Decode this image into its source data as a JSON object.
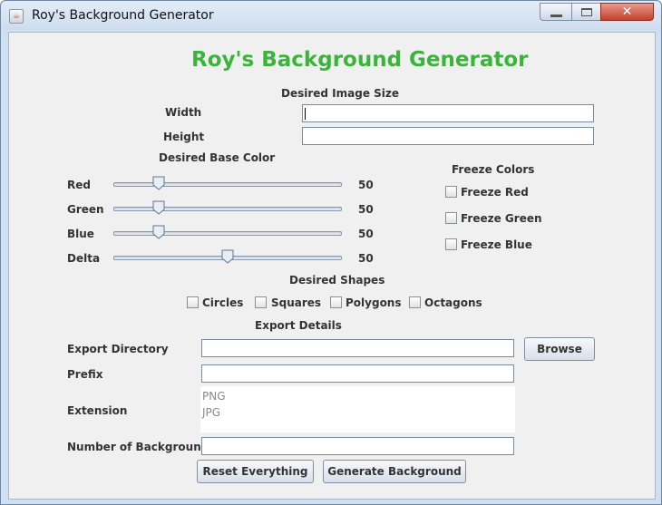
{
  "window": {
    "title": "Roy's Background Generator",
    "icon": "java-app-icon",
    "controls": {
      "minimize": "minimize-icon",
      "maximize": "maximize-icon",
      "close": "✕"
    }
  },
  "heading": "Roy's Background Generator",
  "image_size": {
    "section_label": "Desired Image Size",
    "width_label": "Width",
    "width_value": "",
    "height_label": "Height",
    "height_value": ""
  },
  "base_color": {
    "section_label": "Desired Base Color",
    "sliders": [
      {
        "label": "Red",
        "value": "50",
        "fraction": 0.198
      },
      {
        "label": "Green",
        "value": "50",
        "fraction": 0.198
      },
      {
        "label": "Blue",
        "value": "50",
        "fraction": 0.198
      },
      {
        "label": "Delta",
        "value": "50",
        "fraction": 0.5
      }
    ]
  },
  "freeze": {
    "section_label": "Freeze Colors",
    "items": [
      {
        "label": "Freeze Red",
        "checked": false
      },
      {
        "label": "Freeze Green",
        "checked": false
      },
      {
        "label": "Freeze Blue",
        "checked": false
      }
    ]
  },
  "shapes": {
    "section_label": "Desired Shapes",
    "items": [
      {
        "label": "Circles",
        "checked": false
      },
      {
        "label": "Squares",
        "checked": false
      },
      {
        "label": "Polygons",
        "checked": false
      },
      {
        "label": "Octagons",
        "checked": false
      }
    ]
  },
  "export": {
    "section_label": "Export Details",
    "directory_label": "Export Directory",
    "directory_value": "",
    "browse_label": "Browse",
    "prefix_label": "Prefix",
    "prefix_value": "",
    "extension_label": "Extension",
    "extensions": [
      "PNG",
      "JPG"
    ],
    "count_label": "Number of Backgrounds",
    "count_value": ""
  },
  "actions": {
    "reset_label": "Reset Everything",
    "generate_label": "Generate Background"
  },
  "colors": {
    "heading": "#3cb43c",
    "window_frame": "#cfe0f3",
    "client_bg": "#f0f0f0"
  }
}
